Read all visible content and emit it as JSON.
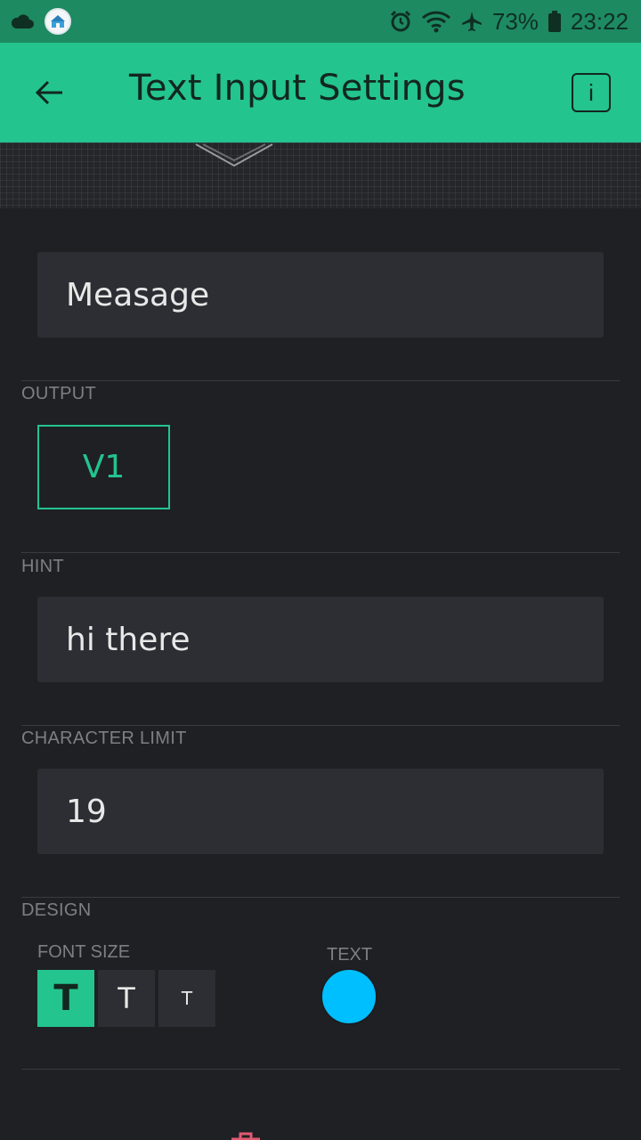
{
  "status": {
    "battery": "73%",
    "time": "23:22",
    "icons": [
      "cloud-icon",
      "app-badge-icon",
      "alarm-icon",
      "wifi-icon",
      "airplane-icon",
      "battery-icon"
    ]
  },
  "appbar": {
    "title": "Text Input Settings",
    "info_label": "i"
  },
  "widget": {
    "name": "Measage"
  },
  "output": {
    "label": "OUTPUT",
    "pin": "V1"
  },
  "hint": {
    "label": "HINT",
    "value": "hi there"
  },
  "character_limit": {
    "label": "CHARACTER LIMIT",
    "value": "19"
  },
  "design": {
    "label": "DESIGN",
    "font_size_label": "FONT SIZE",
    "font_sizes": [
      "T",
      "T",
      "T"
    ],
    "selected_font_size": 0,
    "text_color_label": "TEXT",
    "text_color": "#00bfff"
  },
  "colors": {
    "accent": "#23c48e",
    "status_bar": "#1e8a62",
    "background": "#1f2024",
    "field": "#2d2e33"
  }
}
